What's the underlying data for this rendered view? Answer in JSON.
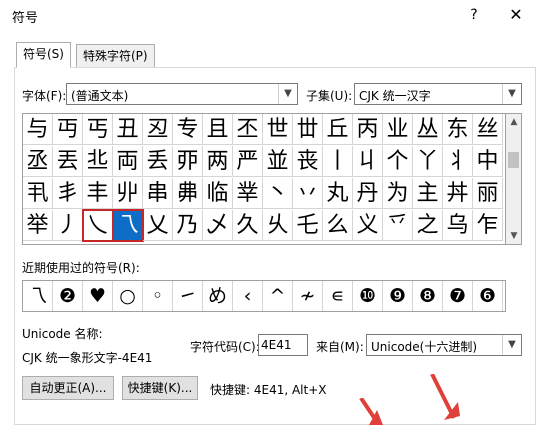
{
  "window": {
    "title": "符号",
    "help_label": "?",
    "close_label": "✕"
  },
  "tabs": [
    {
      "label": "符号(S)"
    },
    {
      "label": "特殊字符(P)"
    }
  ],
  "font": {
    "label": "字体(F):",
    "value": "(普通文本)"
  },
  "subset": {
    "label": "子集(U):",
    "value": "CJK 统一汉字"
  },
  "symbol_grid": [
    [
      "与",
      "丏",
      "丐",
      "丑",
      "丒",
      "专",
      "且",
      "丕",
      "世",
      "丗",
      "丘",
      "丙",
      "业",
      "丛",
      "东",
      "丝"
    ],
    [
      "丞",
      "丟",
      "丠",
      "両",
      "丢",
      "丣",
      "两",
      "严",
      "並",
      "丧",
      "丨",
      "丩",
      "个",
      "丫",
      "丬",
      "中"
    ],
    [
      "丮",
      "丯",
      "丰",
      "丱",
      "串",
      "丳",
      "临",
      "丵",
      "丶",
      "丷",
      "丸",
      "丹",
      "为",
      "主",
      "丼",
      "丽"
    ],
    [
      "举",
      "丿",
      "乀",
      "乁",
      "乂",
      "乃",
      "乄",
      "久",
      "乆",
      "乇",
      "么",
      "义",
      "乊",
      "之",
      "乌",
      "乍"
    ]
  ],
  "selected_symbol": "乁",
  "recent": {
    "label": "近期使用过的符号(R):",
    "symbols": [
      "乁",
      "❷",
      "♥",
      "○",
      "◦",
      "㇀",
      "め",
      "‹",
      "^",
      "≁",
      "∊",
      "❿",
      "❾",
      "❽",
      "❼",
      "❻"
    ]
  },
  "unicode_name": {
    "label": "Unicode 名称:",
    "value": "CJK 统一象形文字-4E41"
  },
  "char_code": {
    "label": "字符代码(C):",
    "value": "4E41"
  },
  "from": {
    "label": "来自(M):",
    "value": "Unicode(十六进制)"
  },
  "buttons": {
    "autocorrect": "自动更正(A)...",
    "shortcut_key": "快捷键(K)..."
  },
  "shortcut_info": "快捷键: 4E41, Alt+X",
  "colors": {
    "selection": "#0e6ec7",
    "highlight_box": "#c62828",
    "arrow": "#e0403a"
  }
}
